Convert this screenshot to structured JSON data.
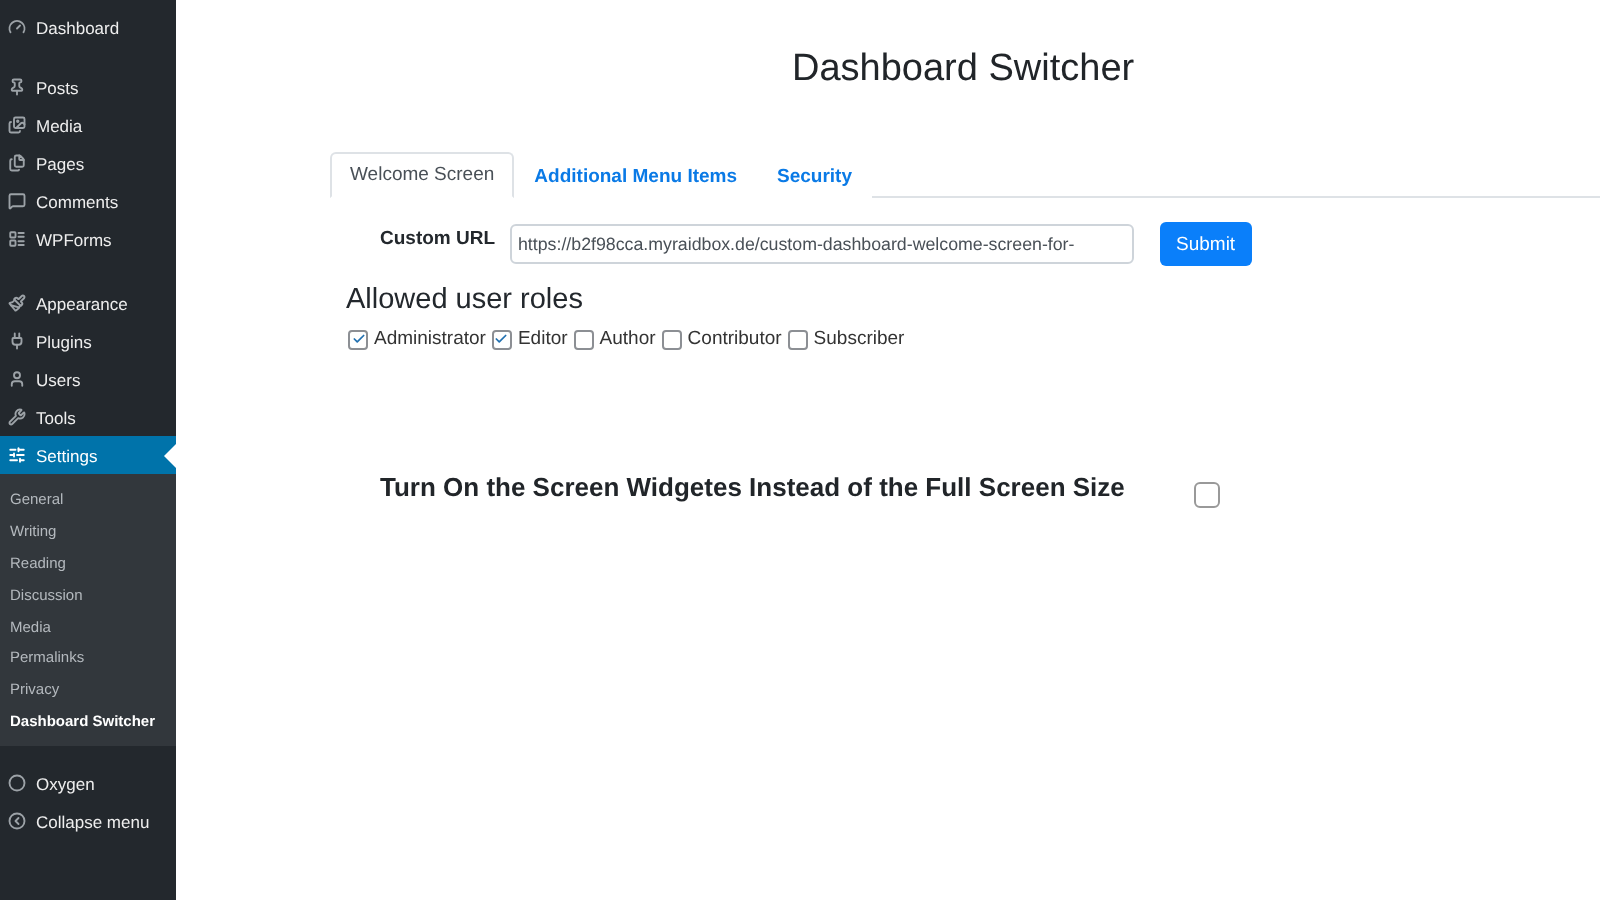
{
  "sidebar": {
    "groups": [
      {
        "items": [
          {
            "label": "Dashboard",
            "selected": false
          }
        ]
      },
      {
        "items": [
          {
            "label": "Posts",
            "selected": false
          },
          {
            "label": "Media",
            "selected": false
          },
          {
            "label": "Pages",
            "selected": false
          },
          {
            "label": "Comments",
            "selected": false
          },
          {
            "label": "WPForms",
            "selected": false
          }
        ]
      },
      {
        "items": [
          {
            "label": "Appearance",
            "selected": false
          },
          {
            "label": "Plugins",
            "selected": false
          },
          {
            "label": "Users",
            "selected": false
          },
          {
            "label": "Tools",
            "selected": false
          },
          {
            "label": "Settings",
            "selected": true,
            "children": [
              {
                "label": "General",
                "selected": false
              },
              {
                "label": "Writing",
                "selected": false
              },
              {
                "label": "Reading",
                "selected": false
              },
              {
                "label": "Discussion",
                "selected": false
              },
              {
                "label": "Media",
                "selected": false
              },
              {
                "label": "Permalinks",
                "selected": false
              },
              {
                "label": "Privacy",
                "selected": false
              },
              {
                "label": "Dashboard Switcher",
                "selected": true
              }
            ]
          }
        ]
      },
      {
        "items": [
          {
            "label": "Oxygen",
            "selected": false
          },
          {
            "label": "Collapse menu",
            "selected": false
          }
        ]
      }
    ]
  },
  "page_title": "Dashboard Switcher",
  "tabs": [
    {
      "label": "Welcome Screen",
      "selected": true
    },
    {
      "label": "Additional Menu Items",
      "selected": false
    },
    {
      "label": "Security",
      "selected": false
    }
  ],
  "custom_url": {
    "label": "Custom URL",
    "value": "https://b2f98cca.myraidbox.de/custom-dashboard-welcome-screen-for-",
    "button": "Submit"
  },
  "roles": {
    "heading": "Allowed user roles",
    "items": [
      {
        "label": "Administrator",
        "checked": true
      },
      {
        "label": "Editor",
        "checked": true
      },
      {
        "label": "Author",
        "checked": false
      },
      {
        "label": "Contributor",
        "checked": false
      },
      {
        "label": "Subscriber",
        "checked": false
      }
    ]
  },
  "widgets_option": {
    "label": "Turn On the Screen Widgetes Instead of the Full Screen Size",
    "checked": false
  }
}
